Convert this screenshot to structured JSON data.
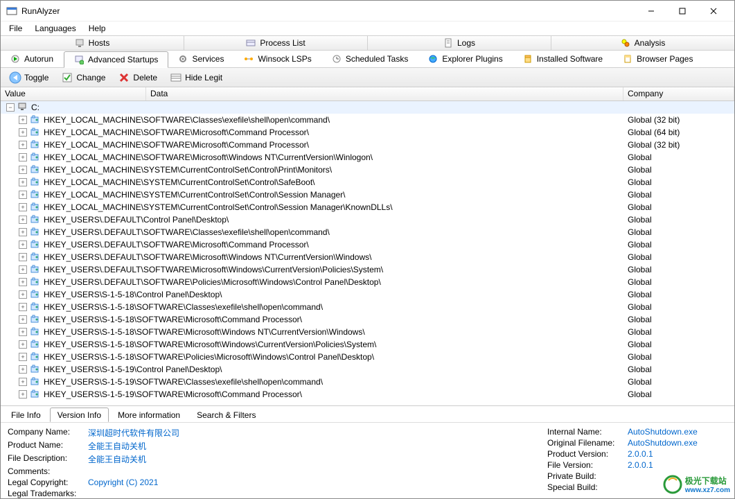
{
  "title": "RunAlyzer",
  "menu": {
    "file": "File",
    "languages": "Languages",
    "help": "Help"
  },
  "main_tabs": {
    "hosts": "Hosts",
    "process_list": "Process List",
    "logs": "Logs",
    "analysis": "Analysis"
  },
  "sub_tabs": {
    "autorun": "Autorun",
    "advanced_startups": "Advanced Startups",
    "services": "Services",
    "winsock_lsps": "Winsock LSPs",
    "scheduled_tasks": "Scheduled Tasks",
    "explorer_plugins": "Explorer Plugins",
    "installed_software": "Installed Software",
    "browser_pages": "Browser Pages"
  },
  "toolbar": {
    "toggle": "Toggle",
    "change": "Change",
    "delete": "Delete",
    "hide_legit": "Hide Legit"
  },
  "columns": {
    "value": "Value",
    "data": "Data",
    "company": "Company"
  },
  "root": "C:",
  "rows": [
    {
      "value": "HKEY_LOCAL_MACHINE\\SOFTWARE\\Classes\\exefile\\shell\\open\\command\\",
      "company": "Global (32 bit)"
    },
    {
      "value": "HKEY_LOCAL_MACHINE\\SOFTWARE\\Microsoft\\Command Processor\\",
      "company": "Global (64 bit)"
    },
    {
      "value": "HKEY_LOCAL_MACHINE\\SOFTWARE\\Microsoft\\Command Processor\\",
      "company": "Global (32 bit)"
    },
    {
      "value": "HKEY_LOCAL_MACHINE\\SOFTWARE\\Microsoft\\Windows NT\\CurrentVersion\\Winlogon\\",
      "company": "Global"
    },
    {
      "value": "HKEY_LOCAL_MACHINE\\SYSTEM\\CurrentControlSet\\Control\\Print\\Monitors\\",
      "company": "Global"
    },
    {
      "value": "HKEY_LOCAL_MACHINE\\SYSTEM\\CurrentControlSet\\Control\\SafeBoot\\",
      "company": "Global"
    },
    {
      "value": "HKEY_LOCAL_MACHINE\\SYSTEM\\CurrentControlSet\\Control\\Session Manager\\",
      "company": "Global"
    },
    {
      "value": "HKEY_LOCAL_MACHINE\\SYSTEM\\CurrentControlSet\\Control\\Session Manager\\KnownDLLs\\",
      "company": "Global"
    },
    {
      "value": "HKEY_USERS\\.DEFAULT\\Control Panel\\Desktop\\",
      "company": "Global"
    },
    {
      "value": "HKEY_USERS\\.DEFAULT\\SOFTWARE\\Classes\\exefile\\shell\\open\\command\\",
      "company": "Global"
    },
    {
      "value": "HKEY_USERS\\.DEFAULT\\SOFTWARE\\Microsoft\\Command Processor\\",
      "company": "Global"
    },
    {
      "value": "HKEY_USERS\\.DEFAULT\\SOFTWARE\\Microsoft\\Windows NT\\CurrentVersion\\Windows\\",
      "company": "Global"
    },
    {
      "value": "HKEY_USERS\\.DEFAULT\\SOFTWARE\\Microsoft\\Windows\\CurrentVersion\\Policies\\System\\",
      "company": "Global"
    },
    {
      "value": "HKEY_USERS\\.DEFAULT\\SOFTWARE\\Policies\\Microsoft\\Windows\\Control Panel\\Desktop\\",
      "company": "Global"
    },
    {
      "value": "HKEY_USERS\\S-1-5-18\\Control Panel\\Desktop\\",
      "company": "Global"
    },
    {
      "value": "HKEY_USERS\\S-1-5-18\\SOFTWARE\\Classes\\exefile\\shell\\open\\command\\",
      "company": "Global"
    },
    {
      "value": "HKEY_USERS\\S-1-5-18\\SOFTWARE\\Microsoft\\Command Processor\\",
      "company": "Global"
    },
    {
      "value": "HKEY_USERS\\S-1-5-18\\SOFTWARE\\Microsoft\\Windows NT\\CurrentVersion\\Windows\\",
      "company": "Global"
    },
    {
      "value": "HKEY_USERS\\S-1-5-18\\SOFTWARE\\Microsoft\\Windows\\CurrentVersion\\Policies\\System\\",
      "company": "Global"
    },
    {
      "value": "HKEY_USERS\\S-1-5-18\\SOFTWARE\\Policies\\Microsoft\\Windows\\Control Panel\\Desktop\\",
      "company": "Global"
    },
    {
      "value": "HKEY_USERS\\S-1-5-19\\Control Panel\\Desktop\\",
      "company": "Global"
    },
    {
      "value": "HKEY_USERS\\S-1-5-19\\SOFTWARE\\Classes\\exefile\\shell\\open\\command\\",
      "company": "Global"
    },
    {
      "value": "HKEY_USERS\\S-1-5-19\\SOFTWARE\\Microsoft\\Command Processor\\",
      "company": "Global"
    }
  ],
  "bottom_tabs": {
    "file_info": "File Info",
    "version_info": "Version Info",
    "more_information": "More information",
    "search_filters": "Search & Filters"
  },
  "info_left": {
    "company_name_label": "Company Name:",
    "company_name_value": "深圳超时代软件有限公司",
    "product_name_label": "Product Name:",
    "product_name_value": "全能王自动关机",
    "file_description_label": "File Description:",
    "file_description_value": "全能王自动关机",
    "comments_label": "Comments:",
    "comments_value": "",
    "legal_copyright_label": "Legal Copyright:",
    "legal_copyright_value": "Copyright (C) 2021",
    "legal_trademarks_label": "Legal Trademarks:",
    "legal_trademarks_value": ""
  },
  "info_right": {
    "internal_name_label": "Internal Name:",
    "internal_name_value": "AutoShutdown.exe",
    "original_filename_label": "Original Filename:",
    "original_filename_value": "AutoShutdown.exe",
    "product_version_label": "Product Version:",
    "product_version_value": "2.0.0.1",
    "file_version_label": "File Version:",
    "file_version_value": "2.0.0.1",
    "private_build_label": "Private Build:",
    "private_build_value": "",
    "special_build_label": "Special Build:",
    "special_build_value": ""
  },
  "watermark": {
    "name": "极光下载站",
    "url": "www.xz7.com"
  }
}
